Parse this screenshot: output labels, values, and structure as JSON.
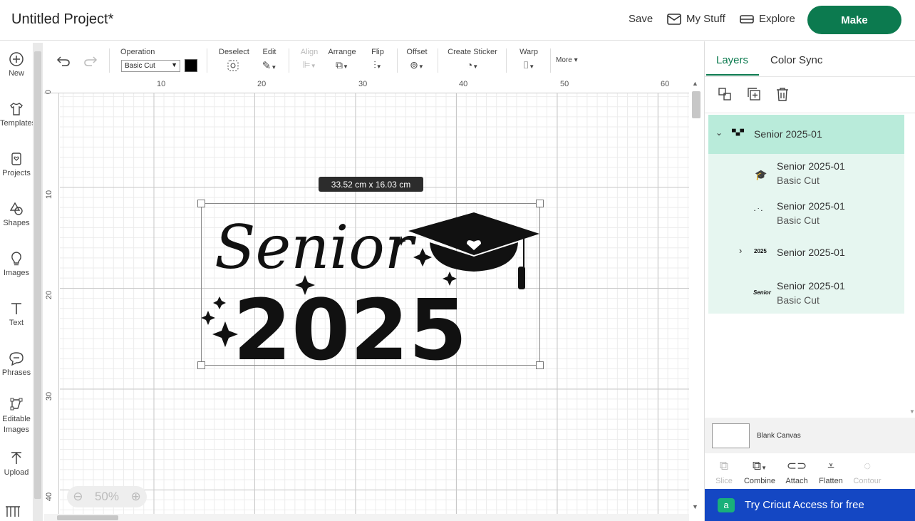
{
  "header": {
    "title": "Untitled Project*",
    "save": "Save",
    "my_stuff": "My Stuff",
    "explore": "Explore",
    "make": "Make"
  },
  "sidebar": {
    "items": [
      {
        "label": "New",
        "icon": "plus-circle-icon"
      },
      {
        "label": "Templates",
        "icon": "shirt-icon"
      },
      {
        "label": "Projects",
        "icon": "projects-icon"
      },
      {
        "label": "Shapes",
        "icon": "shapes-icon"
      },
      {
        "label": "Images",
        "icon": "lightbulb-icon"
      },
      {
        "label": "Text",
        "icon": "text-icon"
      },
      {
        "label": "Phrases",
        "icon": "speech-bubble-icon"
      },
      {
        "label": "Editable Images",
        "icon": "editable-images-icon"
      },
      {
        "label": "Upload",
        "icon": "upload-icon"
      }
    ]
  },
  "toolbar": {
    "operation_label": "Operation",
    "operation_value": "Basic Cut",
    "deselect": "Deselect",
    "edit": "Edit",
    "align": "Align",
    "arrange": "Arrange",
    "flip": "Flip",
    "offset": "Offset",
    "create_sticker": "Create Sticker",
    "warp": "Warp",
    "more": "More"
  },
  "rulers": {
    "top": [
      "10",
      "20",
      "30",
      "40",
      "50",
      "60"
    ],
    "left": [
      "0",
      "10",
      "20",
      "30",
      "40"
    ]
  },
  "canvas": {
    "size_badge": "33.52  cm x 16.03  cm",
    "zoom": "50%",
    "design_word": "Senior",
    "design_year": "2025"
  },
  "panel": {
    "tabs": [
      "Layers",
      "Color Sync"
    ],
    "group_name": "Senior 2025-01",
    "layers": [
      {
        "name": "Senior 2025-01",
        "sub": "Basic Cut"
      },
      {
        "name": "Senior 2025-01",
        "sub": "Basic Cut"
      },
      {
        "name": "Senior 2025-01",
        "sub": ""
      },
      {
        "name": "Senior 2025-01",
        "sub": "Basic Cut"
      }
    ],
    "blank_canvas": "Blank Canvas",
    "actions": [
      "Slice",
      "Combine",
      "Attach",
      "Flatten",
      "Contour"
    ],
    "promo": "Try Cricut Access for free"
  },
  "colors": {
    "brand_green": "#0c7a4f",
    "selected_layer": "#b9ebda",
    "layers_bg": "#e6f6f0",
    "promo_blue": "#1447c3"
  }
}
